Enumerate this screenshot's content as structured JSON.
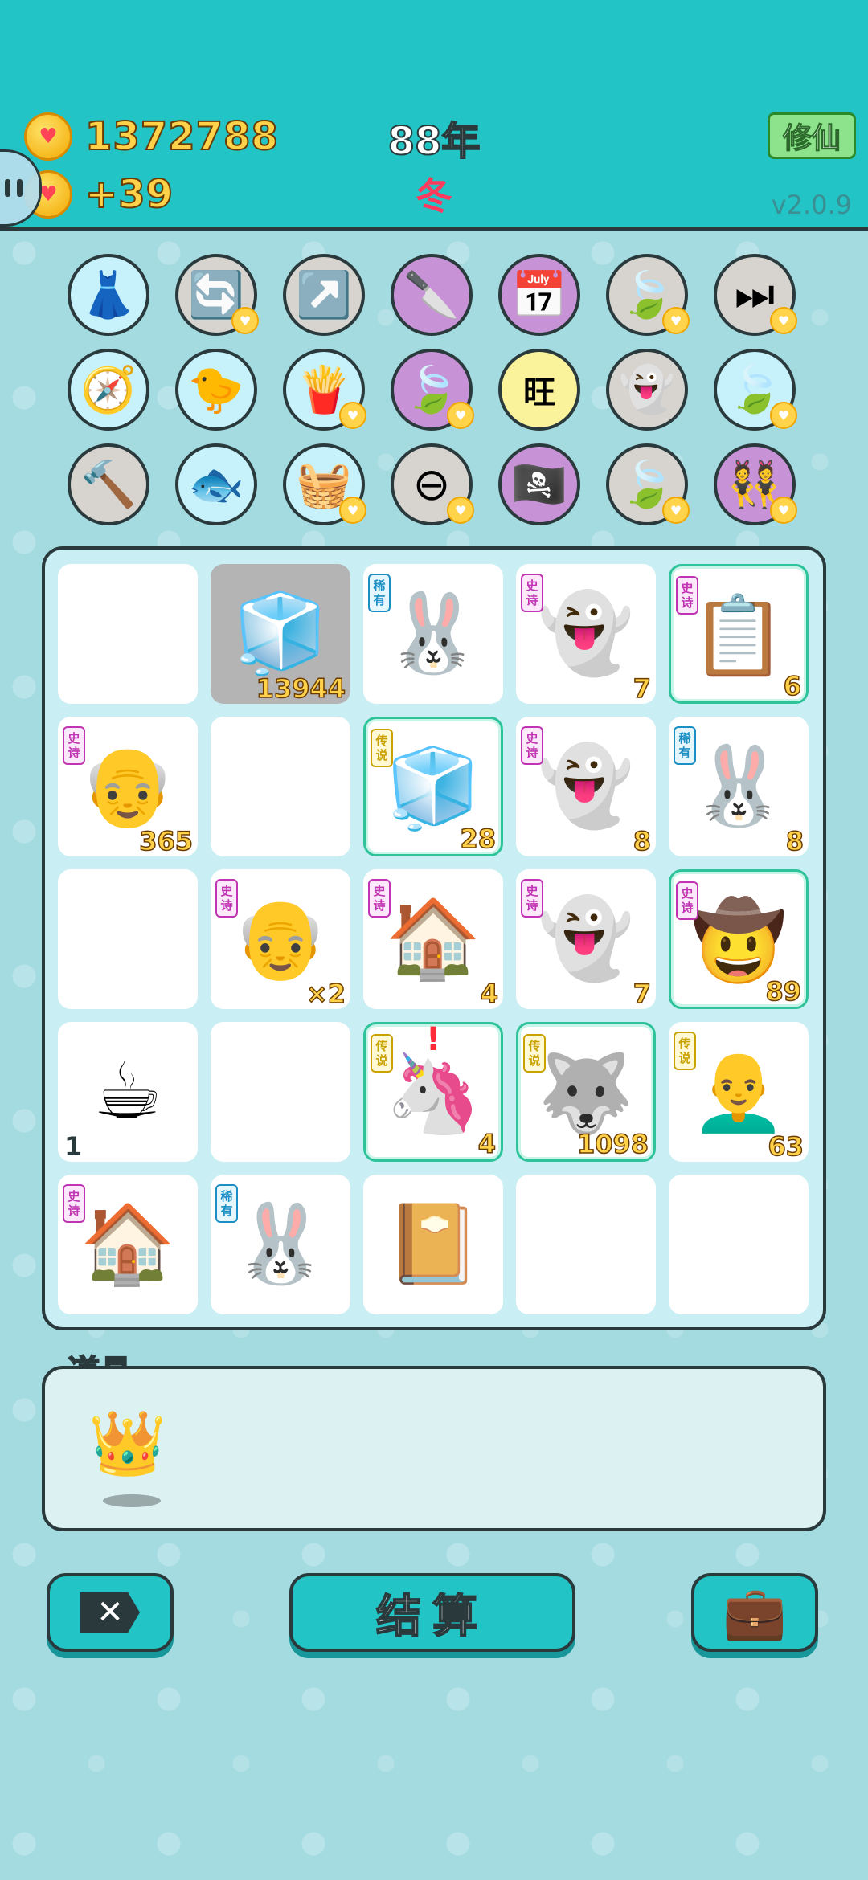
{
  "header": {
    "coins": "1372788",
    "income": "+39",
    "year": "88年",
    "season": "冬",
    "cultivate_label": "修仙",
    "version": "v2.0.9"
  },
  "symbols": [
    {
      "name": "skirt",
      "glyph": "👗",
      "bg": "#c7f1fb",
      "heart": false
    },
    {
      "name": "recycle",
      "glyph": "🔄",
      "bg": "#d7d3cf",
      "heart": true
    },
    {
      "name": "arrow-up-right",
      "glyph": "↗️",
      "bg": "#d7d3cf",
      "heart": false
    },
    {
      "name": "cleaver",
      "glyph": "🔪",
      "bg": "#c893d6",
      "heart": false
    },
    {
      "name": "calendar",
      "glyph": "📅",
      "bg": "#c893d6",
      "heart": false
    },
    {
      "name": "leaf",
      "glyph": "🍃",
      "bg": "#d7d3cf",
      "heart": true
    },
    {
      "name": "skip-bar",
      "glyph": "⏭",
      "bg": "#d7d3cf",
      "heart": true
    },
    {
      "name": "compass",
      "glyph": "🧭",
      "bg": "#c7f1fb",
      "heart": false
    },
    {
      "name": "chick-egg",
      "glyph": "🐤",
      "bg": "#c7f1fb",
      "heart": false
    },
    {
      "name": "fries",
      "glyph": "🍟",
      "bg": "#c7f1fb",
      "heart": true
    },
    {
      "name": "leaf",
      "glyph": "🍃",
      "bg": "#c893d6",
      "heart": true
    },
    {
      "name": "wang-text",
      "glyph": "旺",
      "bg": "#fbf39c",
      "heart": false
    },
    {
      "name": "winking-ghost",
      "glyph": "👻",
      "bg": "#d7d3cf",
      "heart": false
    },
    {
      "name": "leaf",
      "glyph": "🍃",
      "bg": "#c7f1fb",
      "heart": true
    },
    {
      "name": "hammer",
      "glyph": "🔨",
      "bg": "#d7d3cf",
      "heart": false
    },
    {
      "name": "fishbowl",
      "glyph": "🐟",
      "bg": "#c7f1fb",
      "heart": false
    },
    {
      "name": "fruit-basket",
      "glyph": "🧺",
      "bg": "#c7f1fb",
      "heart": true
    },
    {
      "name": "minus-circle",
      "glyph": "⊖",
      "bg": "#d7d3cf",
      "heart": true
    },
    {
      "name": "eyepatch",
      "glyph": "🏴‍☠️",
      "bg": "#c893d6",
      "heart": false
    },
    {
      "name": "leaf",
      "glyph": "🍃",
      "bg": "#d7d3cf",
      "heart": true
    },
    {
      "name": "twins",
      "glyph": "👯",
      "bg": "#c893d6",
      "heart": true
    }
  ],
  "tags": {
    "epic": "史诗",
    "rare": "稀有",
    "legend": "传说"
  },
  "cells": [
    {
      "glyph": "",
      "count": "",
      "tag": "",
      "style": ""
    },
    {
      "glyph": "🧊",
      "count": "13944",
      "tag": "",
      "style": "sel"
    },
    {
      "glyph": "🐰",
      "count": "",
      "tag": "rare",
      "style": ""
    },
    {
      "glyph": "👻",
      "count": "7",
      "tag": "epic",
      "style": ""
    },
    {
      "glyph": "📋",
      "count": "6",
      "tag": "epic",
      "style": "glow"
    },
    {
      "glyph": "👴",
      "count": "365",
      "tag": "epic",
      "style": ""
    },
    {
      "glyph": "",
      "count": "",
      "tag": "",
      "style": ""
    },
    {
      "glyph": "🧊",
      "count": "28",
      "tag": "leg",
      "style": "glow"
    },
    {
      "glyph": "👻",
      "count": "8",
      "tag": "epic",
      "style": ""
    },
    {
      "glyph": "🐰",
      "count": "8",
      "tag": "rare",
      "style": ""
    },
    {
      "glyph": "",
      "count": "",
      "tag": "",
      "style": ""
    },
    {
      "glyph": "👴",
      "count": "×2",
      "tag": "epic",
      "style": ""
    },
    {
      "glyph": "🏠",
      "count": "4",
      "tag": "epic",
      "style": ""
    },
    {
      "glyph": "👻",
      "count": "7",
      "tag": "epic",
      "style": ""
    },
    {
      "glyph": "🤠",
      "count": "89",
      "tag": "epic",
      "style": "glow"
    },
    {
      "glyph": "☕",
      "count": "1",
      "tag": "",
      "style": "",
      "left": true
    },
    {
      "glyph": "",
      "count": "",
      "tag": "",
      "style": ""
    },
    {
      "glyph": "🦄",
      "count": "4",
      "tag": "leg",
      "style": "glow",
      "alert": "!"
    },
    {
      "glyph": "🐺",
      "count": "1098",
      "tag": "leg",
      "style": "glow"
    },
    {
      "glyph": "👨‍🦲",
      "count": "63",
      "tag": "leg",
      "style": ""
    },
    {
      "glyph": "🏠",
      "count": "",
      "tag": "epic",
      "style": ""
    },
    {
      "glyph": "🐰",
      "count": "",
      "tag": "rare",
      "style": ""
    },
    {
      "glyph": "📔",
      "count": "",
      "tag": "",
      "style": ""
    },
    {
      "glyph": "",
      "count": "",
      "tag": "",
      "style": ""
    },
    {
      "glyph": "",
      "count": "",
      "tag": "",
      "style": ""
    }
  ],
  "items": {
    "title": "道具",
    "crown_glyph": "👑"
  },
  "buttons": {
    "settle_label": "结算",
    "close_glyph": "✕",
    "bag_glyph": "💼"
  }
}
